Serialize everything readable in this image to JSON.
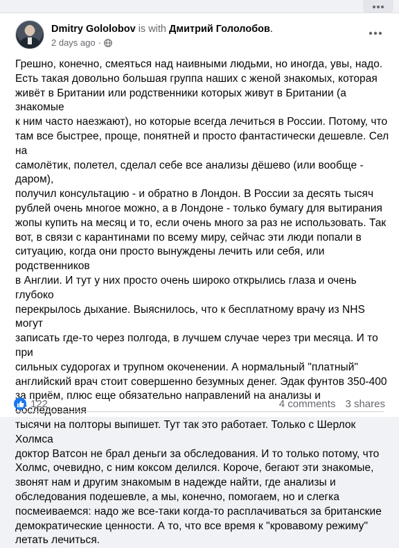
{
  "post": {
    "author": "Dmitry Gololobov",
    "with_text": "is with",
    "tagged": "Дмитрий Гололобов",
    "tagged_suffix": ".",
    "time": "2 days ago",
    "time_separator": "·",
    "privacy_icon": "globe-icon",
    "text": "Грешно, конечно, смеяться над наивными людьми, но иногда, увы, надо.\nЕсть такая довольно большая группа наших с женой знакомых, которая\nживёт в Британии или родственники которых живут в Британии (а знакомые\nк ним часто наезжают), но которые всегда лечиться в России. Потому, что\nтам все быстрее, проще, понятней и просто фантастически дешевле. Сел на\nсамолётик, полетел, сделал себе все анализы дёшево (или вообще - даром),\nполучил консультацию - и обратно в Лондон. В России за десять тысяч\nрублей очень многое можно, а в Лондоне - только бумагу для вытирания\nжопы купить на месяц и то, если очень много за раз не использовать. Так\nвот, в связи с карантинами по всему миру, сейчас эти люди попали в\nситуацию, когда они просто вынуждены лечить или себя, или родственников\nв Англии. И тут у них просто очень широко открылись глаза и очень глубоко\nперекрылось дыхание. Выяснилось, что к бесплатному врачу из NHS  могут\nзаписать где-то через полгода, в лучшем случае через три месяца. И то при\nсильных судорогах и трупном окоченении. А нормальный \"платный\"\nанглийский врач стоит совершенно безумных денег. Эдак фунтов 350-400\nза приём, плюс еще обязательно направлений на анализы и обследования\nтысячи на полторы выпишет. Тут так это работает. Только с Шерлок Холмса\nдоктор Ватсон не брал деньги за обследования. И то только потому, что\nХолмс, очевидно, с ним коксом делился. Короче, бегают эти знакомые,\nзвонят нам и другим знакомым в надежде найти, где анализы и\nобследования подешевле, а мы, конечно, помогаем, но и слегка\nпосмеиваемся: надо же все-таки когда-то расплачиваться за британские\nдемократические ценности. А то, что все время к \"кровавому режиму\"\nлетать лечиться."
  },
  "reactions": {
    "icon": "thumbs-up-icon",
    "count": "122"
  },
  "stats": {
    "comments": "4 comments",
    "shares": "3 shares"
  },
  "colors": {
    "like_blue": "#1877f2",
    "secondary_text": "#65676b",
    "primary_text": "#050505"
  }
}
